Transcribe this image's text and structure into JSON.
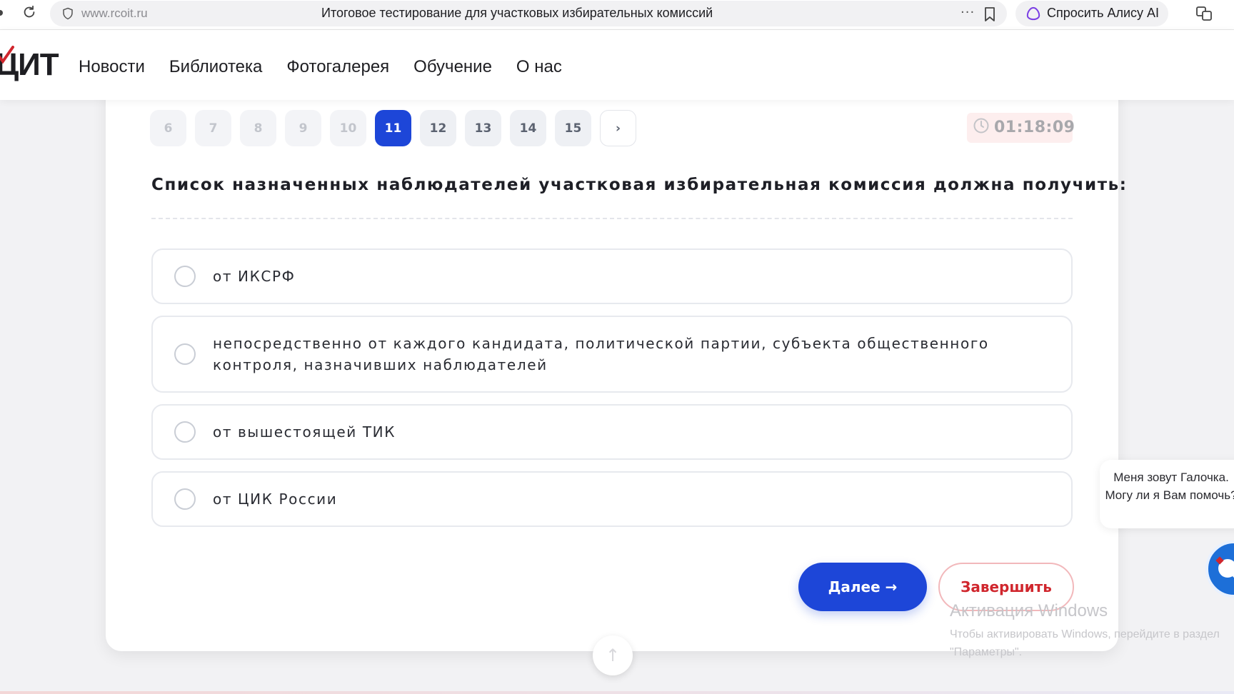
{
  "browser": {
    "url": "www.rcoit.ru",
    "tab_title": "Итоговое тестирование для участковых избирательных комиссий",
    "more_menu": "···",
    "alice_button": "Спросить Алису AI"
  },
  "site": {
    "logo_text": "ЦИТ",
    "nav": [
      "Новости",
      "Библиотека",
      "Фотогалерея",
      "Обучение",
      "О нас"
    ]
  },
  "test": {
    "pages": [
      "6",
      "7",
      "8",
      "9",
      "10",
      "11",
      "12",
      "13",
      "14",
      "15"
    ],
    "current_page": "11",
    "next_page_arrow": "›",
    "timer": "01:18:09",
    "question": "Список назначенных наблюдателей участковая избирательная комиссия должна получить:",
    "answers": [
      "от ИКСРФ",
      "непосредственно от каждого кандидата, политической партии, субъекта общественного контроля, назначивших наблюдателей",
      "от вышестоящей ТИК",
      "от ЦИК России"
    ],
    "next_button": "Далее →",
    "finish_button": "Завершить"
  },
  "scroll_top_arrow": "↑",
  "chat": {
    "message": "Меня зовут Галочка. Могу ли я Вам помочь?"
  },
  "windows_watermark": {
    "title": "Активация Windows",
    "subtitle_line1": "Чтобы активировать Windows, перейдите в раздел",
    "subtitle_line2": "\"Параметры\"."
  },
  "colors": {
    "accent": "#1d46d8",
    "danger": "#d0262d",
    "timer_bg": "#fdeeee"
  }
}
